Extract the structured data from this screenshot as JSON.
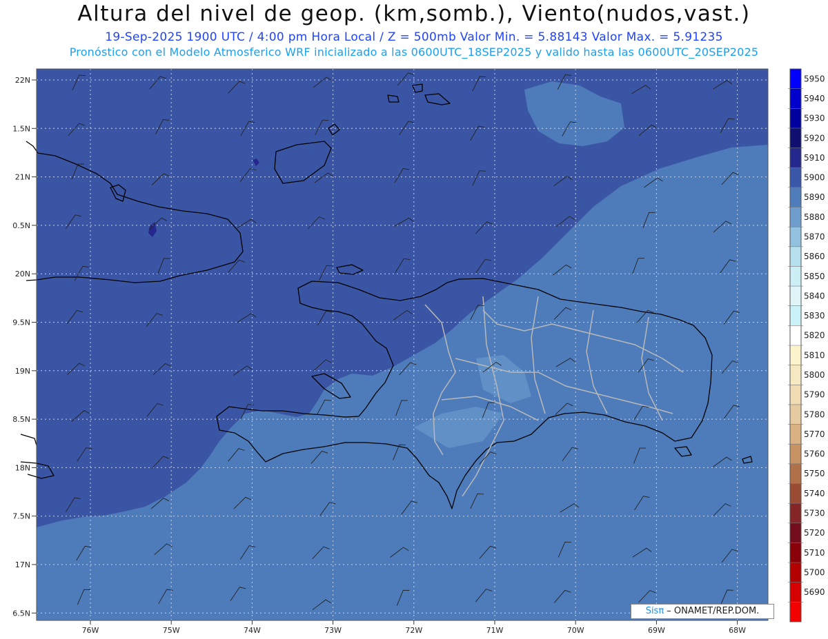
{
  "header": {
    "title": "Altura del nivel de geop. (km,somb.), Viento(nudos,vast.)",
    "subtitle": "19-Sep-2025  1900 UTC / 4:00 pm Hora Local / Z = 500mb    Valor Min. = 5.88143  Valor Max. = 5.91235",
    "model_line": "Pronóstico con el Modelo Atmosferico WRF inicializado a las 0600UTC_18SEP2025 y valido hasta las  0600UTC_20SEP2025"
  },
  "lat_ticks": [
    "22N",
    "1.5N",
    "21N",
    "0.5N",
    "20N",
    "9.5N",
    "19N",
    "8.5N",
    "18N",
    "7.5N",
    "17N",
    "6.5N"
  ],
  "lon_ticks": [
    "76W",
    "75W",
    "74W",
    "73W",
    "72W",
    "71W",
    "70W",
    "69W",
    "68W"
  ],
  "colorbar": {
    "labels": [
      "5950",
      "5940",
      "5930",
      "5920",
      "5910",
      "5900",
      "5890",
      "5880",
      "5870",
      "5860",
      "5850",
      "5840",
      "5830",
      "5820",
      "5810",
      "5800",
      "5790",
      "5780",
      "5770",
      "5760",
      "5750",
      "5740",
      "5730",
      "5720",
      "5710",
      "5700",
      "5690"
    ],
    "colors": [
      "#0000ff",
      "#0000cc",
      "#00009e",
      "#0f0f72",
      "#24288c",
      "#3a56a6",
      "#4f7dbb",
      "#6f9dce",
      "#93c2e0",
      "#b6e0ee",
      "#cceef5",
      "#dff5f8",
      "#c9f3f8",
      "#ffffff",
      "#fcf3cc",
      "#f6e8c1",
      "#efdcb3",
      "#e7cba0",
      "#d9b183",
      "#c79363",
      "#b07049",
      "#9a4c34",
      "#862528",
      "#730c1c",
      "#8a0008",
      "#b30000",
      "#d70000",
      "#f20000"
    ]
  },
  "legend_credit": {
    "sis": "Sisπ",
    "rest": " – ONAMET/REP.DOM."
  },
  "colors": {
    "field_dark": "#3b55a5",
    "field_mid": "#4e7cbb",
    "field_light": "#6a98cb",
    "coast": "#000000",
    "province": "#b9b9b9",
    "grid": "#c8d2e8"
  }
}
